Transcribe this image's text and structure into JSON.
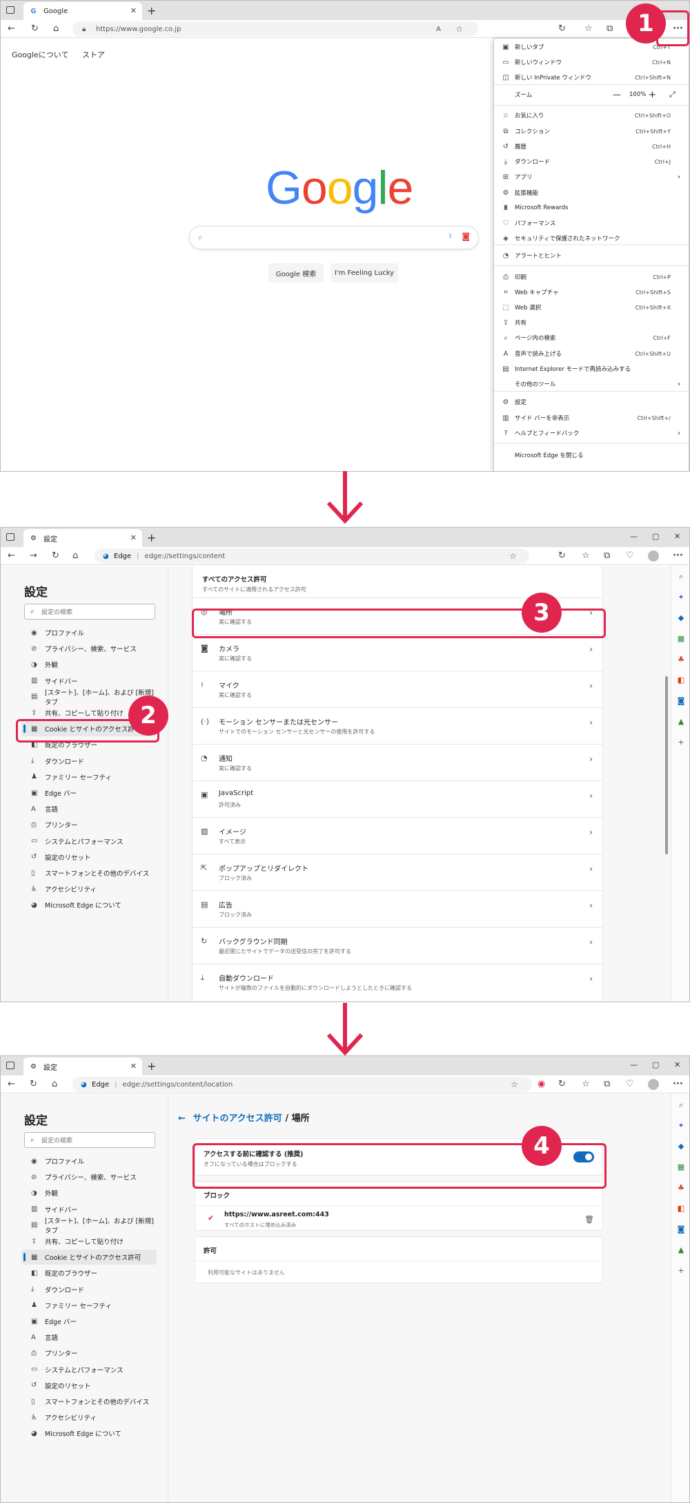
{
  "panel1": {
    "tab_title": "Google",
    "url": "https://www.google.co.jp",
    "google_links": [
      "Googleについて",
      "ストア"
    ],
    "buttons": {
      "search": "Google 検索",
      "lucky": "I'm Feeling Lucky"
    },
    "menu": {
      "items": [
        {
          "label": "新しいタブ",
          "shortcut": "Ctrl+T",
          "icon": "new-tab-icon",
          "glyph": "▣"
        },
        {
          "label": "新しいウィンドウ",
          "shortcut": "Ctrl+N",
          "icon": "new-window-icon",
          "glyph": "▭"
        },
        {
          "label": "新しい InPrivate ウィンドウ",
          "shortcut": "Ctrl+Shift+N",
          "icon": "inprivate-icon",
          "glyph": "◫"
        },
        {
          "label": "ズーム",
          "shortcut": "",
          "icon": "zoom-icon",
          "glyph": ""
        },
        {
          "label": "お気に入り",
          "shortcut": "Ctrl+Shift+O",
          "icon": "favorites-icon",
          "glyph": "☆"
        },
        {
          "label": "コレクション",
          "shortcut": "Ctrl+Shift+Y",
          "icon": "collections-icon",
          "glyph": "⧉"
        },
        {
          "label": "履歴",
          "shortcut": "Ctrl+H",
          "icon": "history-icon",
          "glyph": "↺"
        },
        {
          "label": "ダウンロード",
          "shortcut": "Ctrl+J",
          "icon": "download-icon",
          "glyph": "⤓"
        },
        {
          "label": "アプリ",
          "shortcut": "",
          "icon": "apps-icon",
          "glyph": "⊞",
          "submenu": true
        },
        {
          "label": "拡張機能",
          "shortcut": "",
          "icon": "extensions-icon",
          "glyph": "⚙"
        },
        {
          "label": "Microsoft Rewards",
          "shortcut": "",
          "icon": "rewards-icon",
          "glyph": "♜"
        },
        {
          "label": "パフォーマンス",
          "shortcut": "",
          "icon": "performance-icon",
          "glyph": "♡"
        },
        {
          "label": "セキュリティで保護されたネットワーク",
          "shortcut": "",
          "icon": "secure-network-icon",
          "glyph": "◈"
        },
        {
          "label": "アラートとヒント",
          "shortcut": "",
          "icon": "bell-icon",
          "glyph": "◔"
        },
        {
          "label": "印刷",
          "shortcut": "Ctrl+P",
          "icon": "print-icon",
          "glyph": "⎙"
        },
        {
          "label": "Web キャプチャ",
          "shortcut": "Ctrl+Shift+S",
          "icon": "web-capture-icon",
          "glyph": "⌗"
        },
        {
          "label": "Web 選択",
          "shortcut": "Ctrl+Shift+X",
          "icon": "web-select-icon",
          "glyph": "⬚"
        },
        {
          "label": "共有",
          "shortcut": "",
          "icon": "share-icon",
          "glyph": "⇪"
        },
        {
          "label": "ページ内の検索",
          "shortcut": "Ctrl+F",
          "icon": "find-icon",
          "glyph": "⌕"
        },
        {
          "label": "音声で読み上げる",
          "shortcut": "Ctrl+Shift+U",
          "icon": "read-aloud-icon",
          "glyph": "A"
        },
        {
          "label": "Internet Explorer モードで再読み込みする",
          "shortcut": "",
          "icon": "ie-mode-icon",
          "glyph": "▤"
        },
        {
          "label": "その他のツール",
          "shortcut": "",
          "icon": "",
          "glyph": "",
          "submenu": true
        },
        {
          "label": "設定",
          "shortcut": "",
          "icon": "settings-icon",
          "glyph": "⚙"
        },
        {
          "label": "サイド バーを非表示",
          "shortcut": "Ctrl+Shift+/",
          "icon": "sidebar-icon",
          "glyph": "▥"
        },
        {
          "label": "ヘルプとフィードバック",
          "shortcut": "",
          "icon": "help-icon",
          "glyph": "?",
          "submenu": true
        },
        {
          "label": "Microsoft Edge を閉じる",
          "shortcut": "",
          "icon": "",
          "glyph": ""
        }
      ],
      "zoom_value": "100%"
    }
  },
  "panel2": {
    "tab_title": "設定",
    "url_host": "Edge",
    "url_path": "edge://settings/content",
    "settings_title": "設定",
    "search_placeholder": "設定の検索",
    "section_title": "すべてのアクセス許可",
    "section_sub": "すべてのサイトに適用されるアクセス許可",
    "rows": [
      {
        "title": "場所",
        "sub": "実に確認する",
        "icon": "location-icon",
        "glyph": "◎"
      },
      {
        "title": "カメラ",
        "sub": "実に確認する",
        "icon": "camera-icon",
        "glyph": "◙"
      },
      {
        "title": "マイク",
        "sub": "実に確認する",
        "icon": "mic-icon",
        "glyph": "♮"
      },
      {
        "title": "モーション センサーまたは光センサー",
        "sub": "サイトでのモーション センサーと光センサーの使用を許可する",
        "icon": "sensor-icon",
        "glyph": "(·)"
      },
      {
        "title": "通知",
        "sub": "実に確認する",
        "icon": "bell-icon",
        "glyph": "◔"
      },
      {
        "title": "JavaScript",
        "sub": "許可済み",
        "icon": "javascript-icon",
        "glyph": "▣"
      },
      {
        "title": "イメージ",
        "sub": "すべて表示",
        "icon": "image-icon",
        "glyph": "▨"
      },
      {
        "title": "ポップアップとリダイレクト",
        "sub": "ブロック済み",
        "icon": "popup-icon",
        "glyph": "⇱"
      },
      {
        "title": "広告",
        "sub": "ブロック済み",
        "icon": "ads-icon",
        "glyph": "▤"
      },
      {
        "title": "バックグラウンド同期",
        "sub": "最近閉じたサイトでデータの送受信の完了を許可する",
        "icon": "sync-icon",
        "glyph": "↻"
      },
      {
        "title": "自動ダウンロード",
        "sub": "サイトが複数のファイルを自動的にダウンロードしようとしたときに確認する",
        "icon": "download-icon",
        "glyph": "⤓"
      }
    ]
  },
  "panel3": {
    "tab_title": "設定",
    "url_host": "Edge",
    "url_path": "edge://settings/content/location",
    "settings_title": "設定",
    "search_placeholder": "設定の検索",
    "breadcrumb_parent": "サイトのアクセス許可",
    "breadcrumb_sep": " / ",
    "breadcrumb_current": "場所",
    "ask_title": "アクセスする前に確認する (推奨)",
    "ask_sub": "オフになっている場合はブロックする",
    "ask_toggle_on": true,
    "block_header": "ブロック",
    "blocked_site": "https://www.asreet.com:443",
    "blocked_site_sub": "すべてのホストに埋め込み済み",
    "allow_header": "許可",
    "allow_empty": "利用可能なサイトはありません"
  },
  "sidebar_items": [
    {
      "label": "プロファイル",
      "icon": "profile-icon",
      "glyph": "◉"
    },
    {
      "label": "プライバシー、検索、サービス",
      "icon": "lock-icon",
      "glyph": "⊘"
    },
    {
      "label": "外観",
      "icon": "appearance-icon",
      "glyph": "◑"
    },
    {
      "label": "サイドバー",
      "icon": "sidebar-icon",
      "glyph": "▥"
    },
    {
      "label": "[スタート]、[ホーム]、および [新規] タブ",
      "icon": "start-icon",
      "glyph": "▤"
    },
    {
      "label": "共有、コピーして貼り付け",
      "icon": "share-icon",
      "glyph": "⇪"
    },
    {
      "label": "Cookie とサイトのアクセス許可",
      "icon": "cookie-icon",
      "glyph": "▦"
    },
    {
      "label": "既定のブラウザー",
      "icon": "default-browser-icon",
      "glyph": "◧"
    },
    {
      "label": "ダウンロード",
      "icon": "download-icon",
      "glyph": "⤓"
    },
    {
      "label": "ファミリー セーフティ",
      "icon": "family-icon",
      "glyph": "♟"
    },
    {
      "label": "Edge バー",
      "icon": "edge-bar-icon",
      "glyph": "▣"
    },
    {
      "label": "言語",
      "icon": "language-icon",
      "glyph": "A"
    },
    {
      "label": "プリンター",
      "icon": "printer-icon",
      "glyph": "⎙"
    },
    {
      "label": "システムとパフォーマンス",
      "icon": "system-icon",
      "glyph": "▭"
    },
    {
      "label": "設定のリセット",
      "icon": "reset-icon",
      "glyph": "↺"
    },
    {
      "label": "スマートフォンとその他のデバイス",
      "icon": "phone-icon",
      "glyph": "▯"
    },
    {
      "label": "アクセシビリティ",
      "icon": "accessibility-icon",
      "glyph": "♿"
    },
    {
      "label": "Microsoft Edge について",
      "icon": "edge-logo-icon",
      "glyph": "◕"
    }
  ],
  "step_badges": [
    "1",
    "2",
    "3",
    "4"
  ],
  "colors": {
    "accent": "#e0264e",
    "toggle": "#0f6cbd",
    "link": "#0f6cbd"
  }
}
